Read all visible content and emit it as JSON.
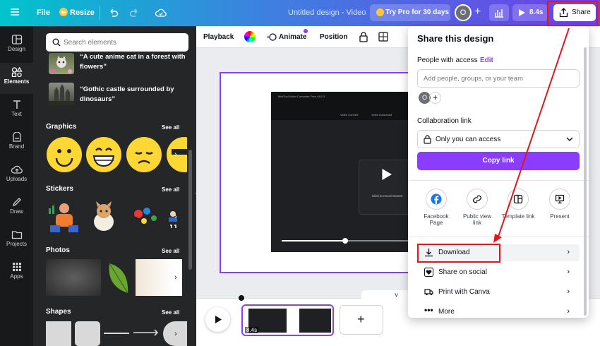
{
  "topbar": {
    "file_label": "File",
    "resize_label": "Resize",
    "title": "Untitled design - Video",
    "try_pro_label": "Try Pro for 30 days",
    "avatar_initial": "O",
    "duration_label": "8.4s",
    "share_label": "Share"
  },
  "rail": {
    "items": [
      {
        "label": "Design",
        "icon": "design-icon"
      },
      {
        "label": "Elements",
        "icon": "elements-icon"
      },
      {
        "label": "Text",
        "icon": "text-icon"
      },
      {
        "label": "Brand",
        "icon": "brand-icon"
      },
      {
        "label": "Uploads",
        "icon": "uploads-icon"
      },
      {
        "label": "Draw",
        "icon": "draw-icon"
      },
      {
        "label": "Projects",
        "icon": "projects-icon"
      },
      {
        "label": "Apps",
        "icon": "apps-icon"
      }
    ]
  },
  "panel": {
    "search_placeholder": "Search elements",
    "ai_items": [
      "“A cute anime cat in a forest with flowers”",
      "“Gothic castle surrounded by dinosaurs”"
    ],
    "sections": {
      "graphics": "Graphics",
      "stickers": "Stickers",
      "photos": "Photos",
      "shapes": "Shapes"
    },
    "see_all": "See all"
  },
  "toolbar": {
    "playback": "Playback",
    "animate": "Animate",
    "position": "Position"
  },
  "canvas": {
    "video_app_title": "MiniTool Video Converter Free v3.6.3",
    "tab1": "Video Convert",
    "tab2": "Video Download",
    "record_hint": "Click to record screen"
  },
  "timeline": {
    "clip_duration": "8.4s"
  },
  "share_panel": {
    "title": "Share this design",
    "people_label": "People with access",
    "edit_label": "Edit",
    "input_placeholder": "Add people, groups, or your team",
    "avatar_initial": "O",
    "collab_label": "Collaboration link",
    "access_value": "Only you can access",
    "copy_link": "Copy link",
    "options": [
      "Facebook Page",
      "Public view link",
      "Template link",
      "Present"
    ],
    "rows": [
      "Download",
      "Share on social",
      "Print with Canva",
      "More"
    ]
  },
  "colors": {
    "brand_purple": "#8b3dff",
    "annotation_red": "#e2161b",
    "dark_panel": "#252627"
  }
}
